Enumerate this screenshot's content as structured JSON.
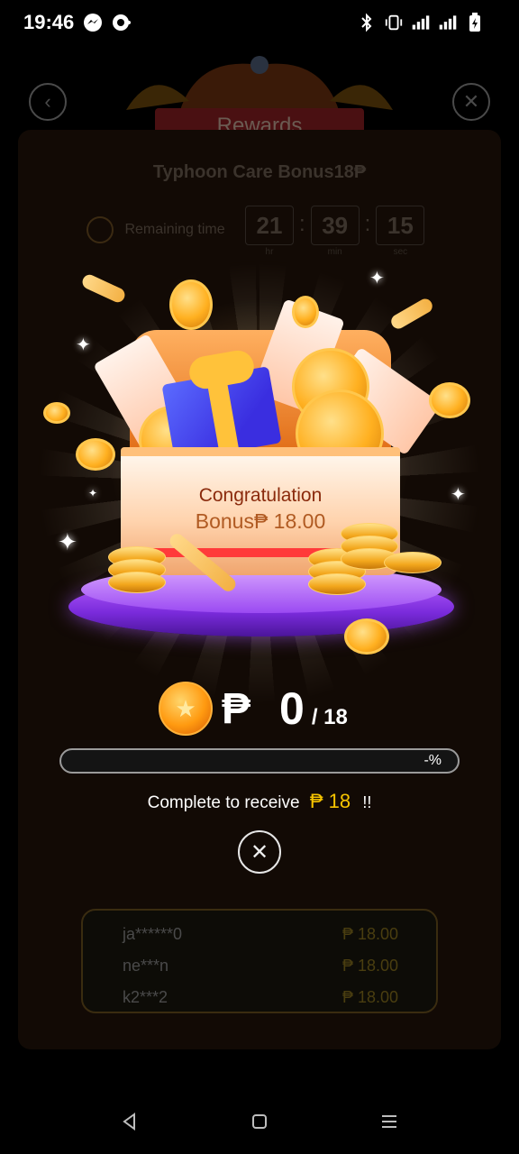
{
  "status_bar": {
    "time": "19:46",
    "left_icons": [
      "messenger-icon",
      "chat-bubble-icon"
    ],
    "right_icons": [
      "bluetooth-icon",
      "vibrate-icon",
      "4g-signal-icon",
      "wifi-signal-icon",
      "battery-charging-icon"
    ]
  },
  "background": {
    "banner_title": "Rewards",
    "subtitle": "Typhoon Care Bonus18₱",
    "remaining_label": "Remaining time",
    "timer": {
      "hr": "21",
      "min": "39",
      "sec": "15"
    },
    "timer_units": {
      "hr": "hr",
      "min": "min",
      "sec": "sec"
    },
    "list": [
      {
        "user": "ja******0",
        "amount": "₱ 18.00"
      },
      {
        "user": "ne***n",
        "amount": "₱ 18.00"
      },
      {
        "user": "k2***2",
        "amount": "₱ 18.00"
      }
    ]
  },
  "modal": {
    "chest_line_1": "Congratulation",
    "chest_line_2": "Bonus₱ 18.00",
    "currency_symbol": "₱",
    "current_amount": "0",
    "target_amount": "/ 18",
    "progress_text": "-%",
    "progress_fraction": 0,
    "receive_text": "Complete to receive",
    "receive_amount": "₱ 18",
    "receive_suffix": "!!",
    "close_symbol": "✕"
  },
  "colors": {
    "accent_gold": "#f6c400",
    "background": "#000000",
    "platform_purple": "#9b4af2"
  },
  "nav_bar": {
    "icons": [
      "back-triangle-icon",
      "home-square-icon",
      "menu-lines-icon"
    ]
  }
}
